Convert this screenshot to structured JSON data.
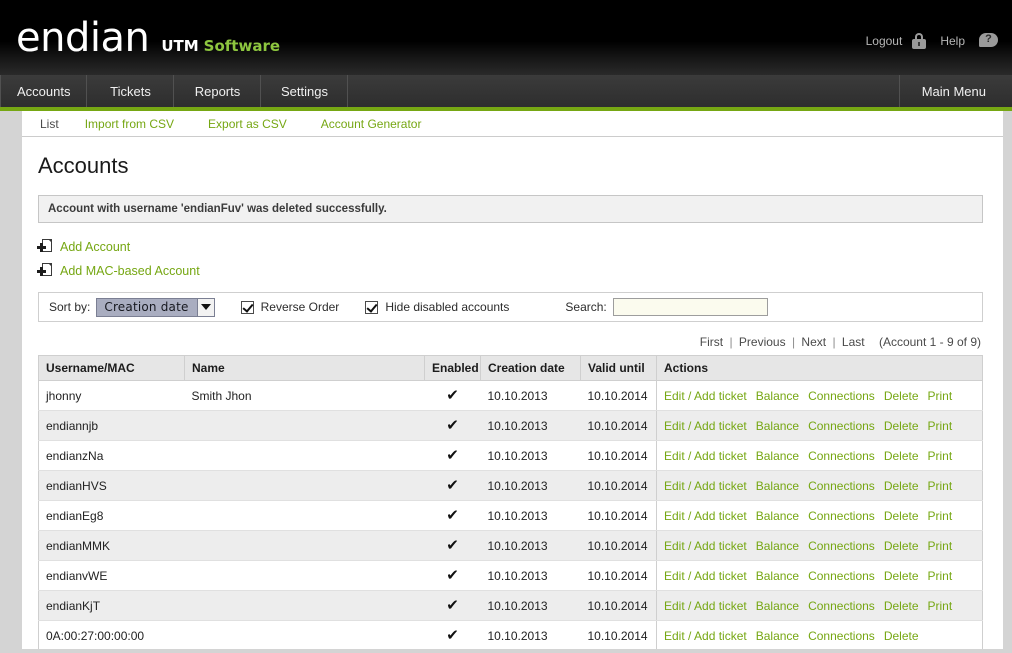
{
  "header": {
    "logo_primary": "endian",
    "logo_utm": "UTM",
    "logo_software": "Software",
    "logout_label": "Logout",
    "help_label": "Help",
    "help_glyph": "?"
  },
  "nav": {
    "tabs": [
      {
        "label": "Accounts"
      },
      {
        "label": "Tickets"
      },
      {
        "label": "Reports"
      },
      {
        "label": "Settings"
      }
    ],
    "main_menu_label": "Main Menu"
  },
  "subnav": {
    "items": [
      {
        "label": "List",
        "active": true
      },
      {
        "label": "Import from CSV",
        "active": false
      },
      {
        "label": "Export as CSV",
        "active": false
      },
      {
        "label": "Account Generator",
        "active": false
      }
    ]
  },
  "main": {
    "page_title": "Accounts",
    "notice": "Account with username 'endianFuv' was deleted successfully.",
    "add_account_label": "Add Account",
    "add_mac_account_label": "Add MAC-based Account"
  },
  "filters": {
    "sort_by_label": "Sort by:",
    "sort_by_value": "Creation date",
    "reverse_order_label": "Reverse Order",
    "reverse_order_checked": true,
    "hide_disabled_label": "Hide disabled accounts",
    "hide_disabled_checked": true,
    "search_label": "Search:",
    "search_value": "",
    "search_placeholder": ""
  },
  "pagination": {
    "first": "First",
    "previous": "Previous",
    "next": "Next",
    "last": "Last",
    "separator": "|",
    "count_text": "(Account 1 - 9 of 9)"
  },
  "table": {
    "columns": [
      "Username/MAC",
      "Name",
      "Enabled",
      "Creation date",
      "Valid until",
      "Actions"
    ],
    "enabled_glyph": "✔",
    "rows": [
      {
        "username": "jhonny",
        "name": "Smith Jhon",
        "enabled": true,
        "creation_date": "10.10.2013",
        "valid_until": "10.10.2014",
        "actions": [
          "Edit / Add ticket",
          "Balance",
          "Connections",
          "Delete",
          "Print"
        ]
      },
      {
        "username": "endiannjb",
        "name": "",
        "enabled": true,
        "creation_date": "10.10.2013",
        "valid_until": "10.10.2014",
        "actions": [
          "Edit / Add ticket",
          "Balance",
          "Connections",
          "Delete",
          "Print"
        ]
      },
      {
        "username": "endianzNa",
        "name": "",
        "enabled": true,
        "creation_date": "10.10.2013",
        "valid_until": "10.10.2014",
        "actions": [
          "Edit / Add ticket",
          "Balance",
          "Connections",
          "Delete",
          "Print"
        ]
      },
      {
        "username": "endianHVS",
        "name": "",
        "enabled": true,
        "creation_date": "10.10.2013",
        "valid_until": "10.10.2014",
        "actions": [
          "Edit / Add ticket",
          "Balance",
          "Connections",
          "Delete",
          "Print"
        ]
      },
      {
        "username": "endianEg8",
        "name": "",
        "enabled": true,
        "creation_date": "10.10.2013",
        "valid_until": "10.10.2014",
        "actions": [
          "Edit / Add ticket",
          "Balance",
          "Connections",
          "Delete",
          "Print"
        ]
      },
      {
        "username": "endianMMK",
        "name": "",
        "enabled": true,
        "creation_date": "10.10.2013",
        "valid_until": "10.10.2014",
        "actions": [
          "Edit / Add ticket",
          "Balance",
          "Connections",
          "Delete",
          "Print"
        ]
      },
      {
        "username": "endianvWE",
        "name": "",
        "enabled": true,
        "creation_date": "10.10.2013",
        "valid_until": "10.10.2014",
        "actions": [
          "Edit / Add ticket",
          "Balance",
          "Connections",
          "Delete",
          "Print"
        ]
      },
      {
        "username": "endianKjT",
        "name": "",
        "enabled": true,
        "creation_date": "10.10.2013",
        "valid_until": "10.10.2014",
        "actions": [
          "Edit / Add ticket",
          "Balance",
          "Connections",
          "Delete",
          "Print"
        ]
      },
      {
        "username": "0A:00:27:00:00:00",
        "name": "",
        "enabled": true,
        "creation_date": "10.10.2013",
        "valid_until": "10.10.2014",
        "actions": [
          "Edit / Add ticket",
          "Balance",
          "Connections",
          "Delete"
        ]
      }
    ]
  },
  "colors": {
    "accent_green": "#76a713",
    "logo_green": "#8dc63f",
    "header_black": "#000000",
    "nav_dark": "#333333",
    "page_gray": "#d4d4d4"
  }
}
